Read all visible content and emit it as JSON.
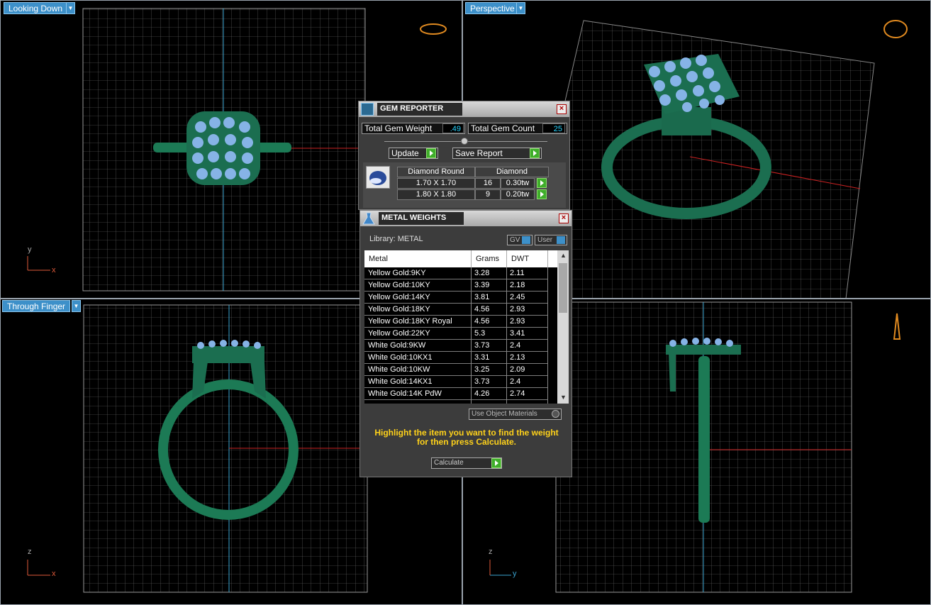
{
  "viewports": {
    "top_left": {
      "label": "Looking Down",
      "axis_y": "y",
      "axis_x": "x"
    },
    "top_right": {
      "label": "Perspective"
    },
    "bottom_left": {
      "label": "Through Finger",
      "axis_y": "z",
      "axis_x": "x"
    },
    "bottom_right": {
      "axis_y": "z",
      "axis_x": "y"
    }
  },
  "gem_reporter": {
    "title": "GEM REPORTER",
    "total_weight_label": "Total Gem Weight",
    "total_weight_value": ".49",
    "total_count_label": "Total Gem Count",
    "total_count_value": "25",
    "update_label": "Update",
    "save_label": "Save Report",
    "table_header": [
      "Diamond Round",
      "Diamond"
    ],
    "rows": [
      {
        "size": "1.70 X 1.70",
        "count": "16",
        "tw": "0.30tw"
      },
      {
        "size": "1.80 X 1.80",
        "count": "9",
        "tw": "0.20tw"
      }
    ]
  },
  "metal_weights": {
    "title": "METAL WEIGHTS",
    "library_label": "Library: METAL",
    "gv_label": "GV",
    "user_label": "User",
    "headers": [
      "Metal",
      "Grams",
      "DWT"
    ],
    "rows": [
      {
        "metal": "Yellow Gold:9KY",
        "grams": "3.28",
        "dwt": "2.11"
      },
      {
        "metal": "Yellow Gold:10KY",
        "grams": "3.39",
        "dwt": "2.18"
      },
      {
        "metal": "Yellow Gold:14KY",
        "grams": "3.81",
        "dwt": "2.45"
      },
      {
        "metal": "Yellow Gold:18KY",
        "grams": "4.56",
        "dwt": "2.93"
      },
      {
        "metal": "Yellow Gold:18KY Royal",
        "grams": "4.56",
        "dwt": "2.93"
      },
      {
        "metal": "Yellow Gold:22KY",
        "grams": "5.3",
        "dwt": "3.41"
      },
      {
        "metal": "White Gold:9KW",
        "grams": "3.73",
        "dwt": "2.4"
      },
      {
        "metal": "White Gold:10KX1",
        "grams": "3.31",
        "dwt": "2.13"
      },
      {
        "metal": "White Gold:10KW",
        "grams": "3.25",
        "dwt": "2.09"
      },
      {
        "metal": "White Gold:14KX1",
        "grams": "3.73",
        "dwt": "2.4"
      },
      {
        "metal": "White Gold:14K PdW",
        "grams": "4.26",
        "dwt": "2.74"
      }
    ],
    "use_object_materials": "Use Object Materials",
    "instruction": "Highlight the item you want to find the weight for then press Calculate.",
    "calculate_label": "Calculate"
  },
  "colors": {
    "ring": "#1f7a5a",
    "gem": "#8fb8e8",
    "grid": "#8a8a8a",
    "label_bg": "#3d90c9",
    "instruction": "#ffd21a"
  }
}
